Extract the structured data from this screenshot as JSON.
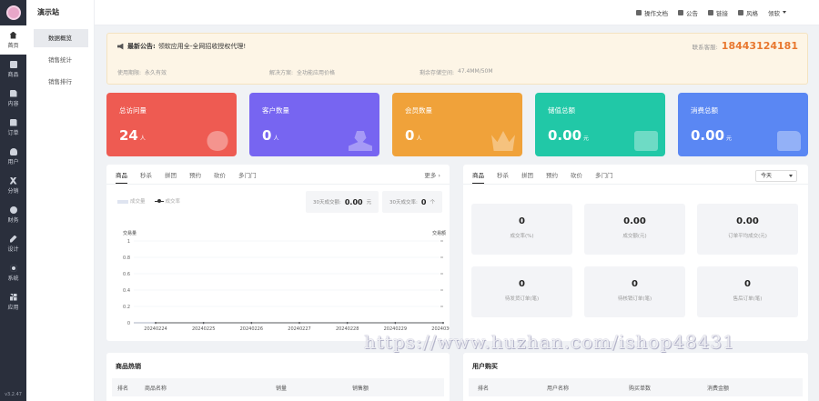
{
  "app": {
    "site_name": "演示站",
    "version": "v3.2.47"
  },
  "rail": [
    {
      "label": "首页",
      "icon": "home-icon"
    },
    {
      "label": "商品",
      "icon": "box-icon"
    },
    {
      "label": "内容",
      "icon": "document-icon"
    },
    {
      "label": "订单",
      "icon": "order-icon"
    },
    {
      "label": "用户",
      "icon": "user-icon"
    },
    {
      "label": "分销",
      "icon": "share-icon"
    },
    {
      "label": "财务",
      "icon": "money-bag-icon"
    },
    {
      "label": "设计",
      "icon": "design-icon"
    },
    {
      "label": "系统",
      "icon": "gear-icon"
    },
    {
      "label": "应用",
      "icon": "apps-icon"
    }
  ],
  "submenu": [
    "数据概览",
    "销售统计",
    "销售排行"
  ],
  "topbar": {
    "docs": "操作文档",
    "notice": "公告",
    "link": "链接",
    "style": "风格",
    "user": "领软"
  },
  "notice": {
    "label": "最新公告:",
    "text": "领软应用全-全网招收授权代理!",
    "contact_label": "联系客服:",
    "contact_value": "18443124181",
    "term_label": "使用期限:",
    "term_value": "永久有效",
    "solution_label": "解决方案:",
    "solution_value": "全功能应用价格",
    "storage_label": "剩余存储空间:",
    "storage_value": "47.4MM/50M"
  },
  "stats": [
    {
      "title": "总访问量",
      "value": "24",
      "unit": "人",
      "color": "#ee5b52",
      "icon": "paw-icon"
    },
    {
      "title": "客户数量",
      "value": "0",
      "unit": "人",
      "color": "#7765f1",
      "icon": "person-icon"
    },
    {
      "title": "会员数量",
      "value": "0",
      "unit": "人",
      "color": "#f0a23a",
      "icon": "crown-icon"
    },
    {
      "title": "储值总额",
      "value": "0.00",
      "unit": "元",
      "color": "#21c8a7",
      "icon": "card-icon"
    },
    {
      "title": "消费总额",
      "value": "0.00",
      "unit": "元",
      "color": "#5a87f3",
      "icon": "wallet-icon"
    }
  ],
  "chart_panel": {
    "tabs": [
      "商品",
      "秒杀",
      "拼团",
      "预约",
      "砍价",
      "多门门"
    ],
    "more": "更多 ›",
    "legend_bar": "成交量",
    "legend_line": "成交率",
    "box1_label": "30天成交额:",
    "box1_value": "0.00",
    "box1_unit": "元",
    "box2_label": "30天成交率:",
    "box2_value": "0",
    "box2_unit": "个"
  },
  "chart_data": {
    "type": "line",
    "x": [
      "20240224",
      "20240225",
      "20240226",
      "20240227",
      "20240228",
      "20240229",
      "20240301"
    ],
    "series": [
      {
        "name": "成交量",
        "values": [
          0,
          0,
          0,
          0,
          0,
          0,
          0
        ]
      },
      {
        "name": "成交率",
        "values": [
          0,
          0,
          0,
          0,
          0,
          0,
          0
        ]
      }
    ],
    "ylabel": "交易量",
    "y2label": "交易额",
    "yticks": [
      "0",
      "0.2",
      "0.4",
      "0.6",
      "0.8",
      "1"
    ],
    "ylim": [
      0,
      1
    ]
  },
  "metrics_panel": {
    "tabs": [
      "商品",
      "秒杀",
      "拼团",
      "预约",
      "砍价",
      "多门门"
    ],
    "select": "今天",
    "items": [
      {
        "value": "0",
        "label": "成交率(%)"
      },
      {
        "value": "0.00",
        "label": "成交额(元)"
      },
      {
        "value": "0.00",
        "label": "订单平均成交(元)"
      },
      {
        "value": "0",
        "label": "待发货订单(笔)"
      },
      {
        "value": "0",
        "label": "待核销订单(笔)"
      },
      {
        "value": "0",
        "label": "售后订单(笔)"
      }
    ]
  },
  "hot_goods": {
    "title": "商品热销",
    "cols": [
      "排名",
      "商品名称",
      "销量",
      "销售额"
    ]
  },
  "user_buy": {
    "title": "用户购买",
    "cols": [
      "排名",
      "用户名称",
      "购买单数",
      "消费金额"
    ]
  },
  "watermark": "https://www.huzhan.com/ishop48431"
}
